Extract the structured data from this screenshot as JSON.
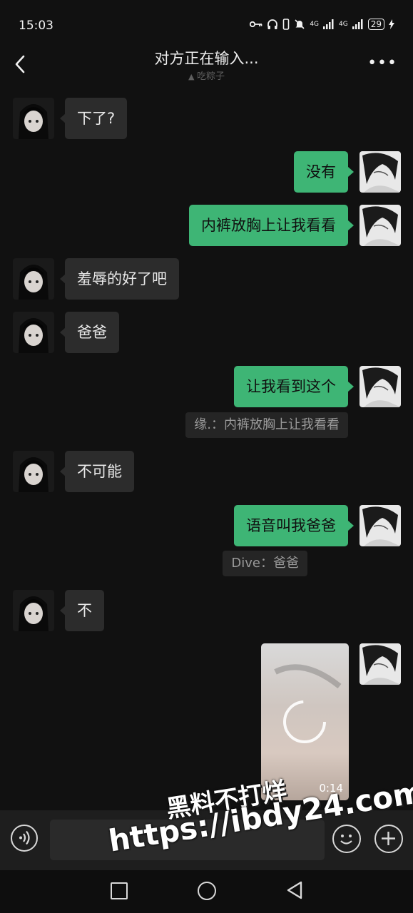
{
  "status_bar": {
    "time": "15:03",
    "network": "4G",
    "network2": "4G",
    "battery": "29"
  },
  "header": {
    "title": "对方正在输入...",
    "subtitle": "吃粽子",
    "more": "•••"
  },
  "messages": [
    {
      "side": "in",
      "text": "下了?"
    },
    {
      "side": "out",
      "text": "没有"
    },
    {
      "side": "out",
      "text": "内裤放胸上让我看看"
    },
    {
      "side": "in",
      "text": "羞辱的好了吧"
    },
    {
      "side": "in",
      "text": "爸爸"
    },
    {
      "side": "out",
      "text": "让我看到这个",
      "quote": "缘.：内裤放胸上让我看看"
    },
    {
      "side": "in",
      "text": "不可能"
    },
    {
      "side": "out",
      "text": "语音叫我爸爸",
      "quote": "Dive：爸爸"
    },
    {
      "side": "in",
      "text": "不"
    },
    {
      "side": "out",
      "type": "video",
      "duration": "0:14"
    }
  ],
  "watermark": {
    "line1": "黑料不打烊",
    "line2": "https://ibdy24.com"
  },
  "colors": {
    "outgoing_bubble": "#3eb575",
    "incoming_bubble": "#2c2c2c",
    "background": "#111111"
  },
  "icons": {
    "voice": "voice-icon",
    "emoji": "emoji-icon",
    "plus": "plus-icon",
    "back": "chevron-left-icon"
  }
}
